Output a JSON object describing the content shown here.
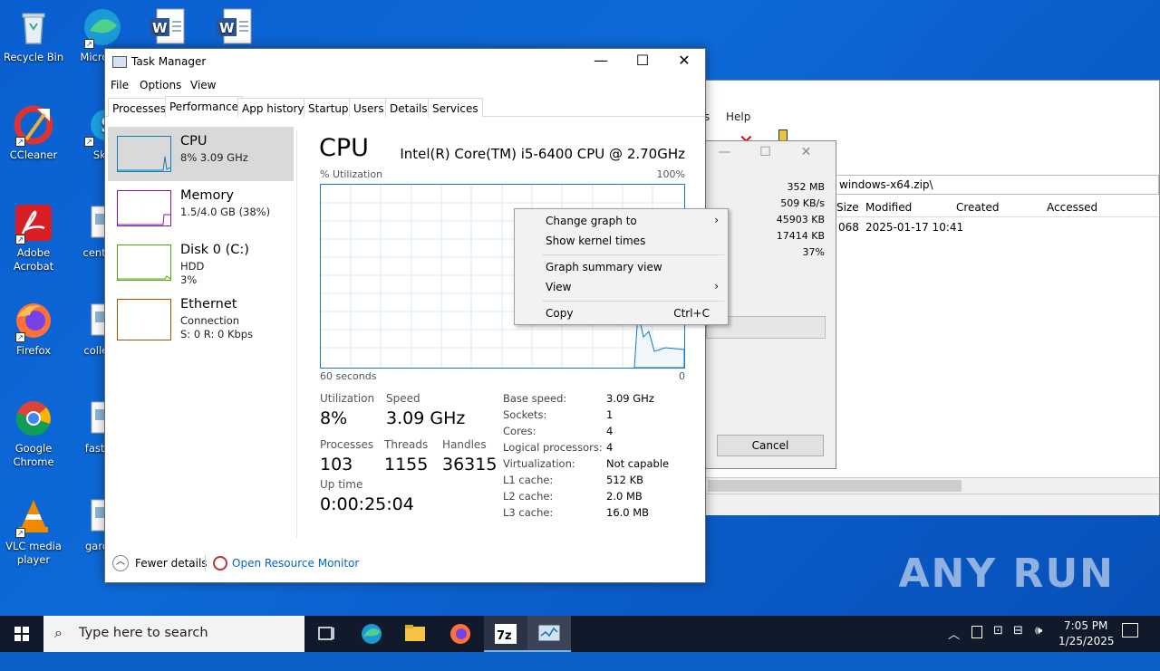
{
  "desktop": {
    "icons": [
      {
        "label": "Recycle Bin"
      },
      {
        "label": "Micro Ed"
      },
      {
        "label": "CCleaner"
      },
      {
        "label": "Sky"
      },
      {
        "label": "Adobe Acrobat"
      },
      {
        "label": "centers"
      },
      {
        "label": "Firefox"
      },
      {
        "label": "college"
      },
      {
        "label": "Google Chrome"
      },
      {
        "label": "fastnic"
      },
      {
        "label": "VLC media player"
      },
      {
        "label": "garder"
      }
    ],
    "watermark": "ANY RUN"
  },
  "background_window": {
    "menu_help": "Help",
    "menu_partial": "s",
    "address": "windows-x64.zip\\",
    "columns": [
      "Size",
      "Modified",
      "Created",
      "Accessed"
    ],
    "row": {
      "size": "068",
      "modified": "2025-01-17 10:41"
    }
  },
  "progress_dialog": {
    "values": [
      "352 MB",
      "509 KB/s",
      "45903 KB",
      "17414 KB",
      "37%"
    ],
    "cancel_label": "Cancel"
  },
  "task_manager": {
    "title": "Task Manager",
    "menu": [
      "File",
      "Options",
      "View"
    ],
    "tabs": [
      "Processes",
      "Performance",
      "App history",
      "Startup",
      "Users",
      "Details",
      "Services"
    ],
    "active_tab": "Performance",
    "sidebar": [
      {
        "name": "CPU",
        "line1": "8% 3.09 GHz",
        "line2": "",
        "color": "#117dbb"
      },
      {
        "name": "Memory",
        "line1": "1.5/4.0 GB (38%)",
        "line2": "",
        "color": "#8b12ae"
      },
      {
        "name": "Disk 0 (C:)",
        "line1": "HDD",
        "line2": "3%",
        "color": "#4da60c"
      },
      {
        "name": "Ethernet",
        "line1": "Connection",
        "line2": "S: 0 R: 0 Kbps",
        "color": "#a74f01"
      }
    ],
    "main": {
      "title": "CPU",
      "cpu_name": "Intel(R) Core(TM) i5-6400 CPU @ 2.70GHz",
      "util_label": "% Utilization",
      "util_max": "100%",
      "x_left": "60 seconds",
      "x_right": "0",
      "stats": {
        "utilization_label": "Utilization",
        "utilization": "8%",
        "speed_label": "Speed",
        "speed": "3.09 GHz",
        "processes_label": "Processes",
        "processes": "103",
        "threads_label": "Threads",
        "threads": "1155",
        "handles_label": "Handles",
        "handles": "36315",
        "uptime_label": "Up time",
        "uptime": "0:00:25:04"
      },
      "specs": [
        {
          "k": "Base speed:",
          "v": "3.09 GHz"
        },
        {
          "k": "Sockets:",
          "v": "1"
        },
        {
          "k": "Cores:",
          "v": "4"
        },
        {
          "k": "Logical processors:",
          "v": "4"
        },
        {
          "k": "Virtualization:",
          "v": "Not capable"
        },
        {
          "k": "L1 cache:",
          "v": "512 KB"
        },
        {
          "k": "L2 cache:",
          "v": "2.0 MB"
        },
        {
          "k": "L3 cache:",
          "v": "16.0 MB"
        }
      ]
    },
    "footer": {
      "fewer": "Fewer details",
      "monitor": "Open Resource Monitor"
    }
  },
  "context_menu": {
    "items": [
      "Change graph to",
      "Show kernel times",
      "Graph summary view",
      "View",
      "Copy"
    ],
    "copy_shortcut": "Ctrl+C"
  },
  "taskbar": {
    "search_placeholder": "Type here to search",
    "time": "7:05 PM",
    "date": "1/25/2025"
  }
}
